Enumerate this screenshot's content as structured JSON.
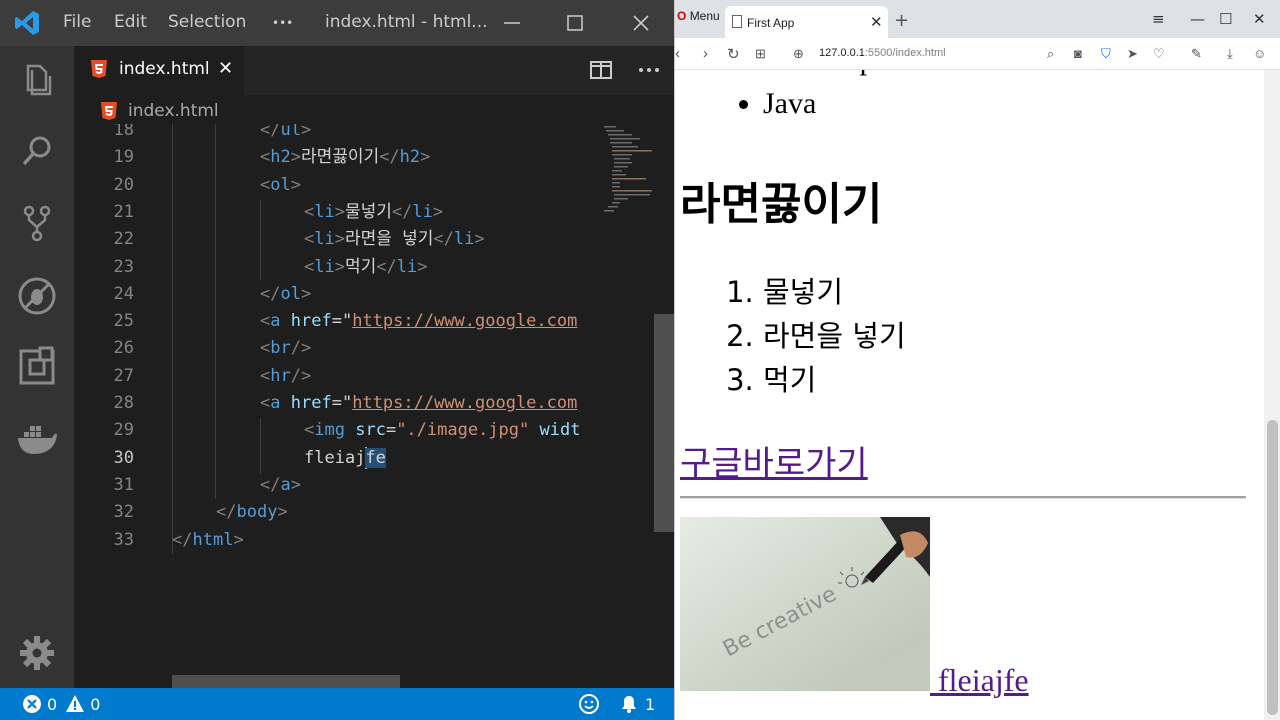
{
  "vscode": {
    "menu": [
      "File",
      "Edit",
      "Selection",
      "•••"
    ],
    "window_title": "index.html - html...",
    "tab": {
      "filename": "index.html",
      "close": "✕"
    },
    "breadcrumb": "index.html",
    "lines": [
      {
        "num": "18",
        "indent": 2,
        "parts": [
          {
            "t": "</",
            "c": "brk"
          },
          {
            "t": "ul",
            "c": "tag"
          },
          {
            "t": ">",
            "c": "brk"
          }
        ]
      },
      {
        "num": "19",
        "indent": 2,
        "parts": [
          {
            "t": "<",
            "c": "brk"
          },
          {
            "t": "h2",
            "c": "tag"
          },
          {
            "t": ">",
            "c": "brk"
          },
          {
            "t": "라면끓이기",
            "c": "txt"
          },
          {
            "t": "</",
            "c": "brk"
          },
          {
            "t": "h2",
            "c": "tag"
          },
          {
            "t": ">",
            "c": "brk"
          }
        ]
      },
      {
        "num": "20",
        "indent": 2,
        "parts": [
          {
            "t": "<",
            "c": "brk"
          },
          {
            "t": "ol",
            "c": "tag"
          },
          {
            "t": ">",
            "c": "brk"
          }
        ]
      },
      {
        "num": "21",
        "indent": 3,
        "parts": [
          {
            "t": "<",
            "c": "brk"
          },
          {
            "t": "li",
            "c": "tag"
          },
          {
            "t": ">",
            "c": "brk"
          },
          {
            "t": "물넣기",
            "c": "txt"
          },
          {
            "t": "</",
            "c": "brk"
          },
          {
            "t": "li",
            "c": "tag"
          },
          {
            "t": ">",
            "c": "brk"
          }
        ]
      },
      {
        "num": "22",
        "indent": 3,
        "parts": [
          {
            "t": "<",
            "c": "brk"
          },
          {
            "t": "li",
            "c": "tag"
          },
          {
            "t": ">",
            "c": "brk"
          },
          {
            "t": "라면을 넣기",
            "c": "txt"
          },
          {
            "t": "</",
            "c": "brk"
          },
          {
            "t": "li",
            "c": "tag"
          },
          {
            "t": ">",
            "c": "brk"
          }
        ]
      },
      {
        "num": "23",
        "indent": 3,
        "parts": [
          {
            "t": "<",
            "c": "brk"
          },
          {
            "t": "li",
            "c": "tag"
          },
          {
            "t": ">",
            "c": "brk"
          },
          {
            "t": "먹기",
            "c": "txt"
          },
          {
            "t": "</",
            "c": "brk"
          },
          {
            "t": "li",
            "c": "tag"
          },
          {
            "t": ">",
            "c": "brk"
          }
        ]
      },
      {
        "num": "24",
        "indent": 2,
        "parts": [
          {
            "t": "</",
            "c": "brk"
          },
          {
            "t": "ol",
            "c": "tag"
          },
          {
            "t": ">",
            "c": "brk"
          }
        ]
      },
      {
        "num": "25",
        "indent": 2,
        "parts": [
          {
            "t": "<",
            "c": "brk"
          },
          {
            "t": "a",
            "c": "tag"
          },
          {
            "t": " ",
            "c": "txt"
          },
          {
            "t": "href",
            "c": "attr"
          },
          {
            "t": "=\"",
            "c": "txt"
          },
          {
            "t": "https://www.google.com",
            "c": "str link"
          }
        ]
      },
      {
        "num": "26",
        "indent": 2,
        "parts": [
          {
            "t": "<",
            "c": "brk"
          },
          {
            "t": "br",
            "c": "tag"
          },
          {
            "t": "/>",
            "c": "brk"
          }
        ]
      },
      {
        "num": "27",
        "indent": 2,
        "parts": [
          {
            "t": "<",
            "c": "brk"
          },
          {
            "t": "hr",
            "c": "tag"
          },
          {
            "t": "/>",
            "c": "brk"
          }
        ]
      },
      {
        "num": "28",
        "indent": 2,
        "parts": [
          {
            "t": "<",
            "c": "brk"
          },
          {
            "t": "a",
            "c": "tag"
          },
          {
            "t": " ",
            "c": "txt"
          },
          {
            "t": "href",
            "c": "attr"
          },
          {
            "t": "=\"",
            "c": "txt"
          },
          {
            "t": "https://www.google.com",
            "c": "str link"
          }
        ]
      },
      {
        "num": "29",
        "indent": 3,
        "parts": [
          {
            "t": "<",
            "c": "brk"
          },
          {
            "t": "img",
            "c": "tag"
          },
          {
            "t": " ",
            "c": "txt"
          },
          {
            "t": "src",
            "c": "attr"
          },
          {
            "t": "=",
            "c": "txt"
          },
          {
            "t": "\"./image.jpg\"",
            "c": "str"
          },
          {
            "t": " ",
            "c": "txt"
          },
          {
            "t": "widt",
            "c": "attr"
          }
        ]
      },
      {
        "num": "30",
        "indent": 3,
        "active": true,
        "parts": [
          {
            "t": "fleiaj",
            "c": "txt"
          },
          {
            "t": "|",
            "c": "cursor"
          },
          {
            "t": "fe",
            "c": "txt sel"
          }
        ]
      },
      {
        "num": "31",
        "indent": 2,
        "parts": [
          {
            "t": "</",
            "c": "brk"
          },
          {
            "t": "a",
            "c": "tag"
          },
          {
            "t": ">",
            "c": "brk"
          }
        ]
      },
      {
        "num": "32",
        "indent": 1,
        "parts": [
          {
            "t": "</",
            "c": "brk"
          },
          {
            "t": "body",
            "c": "tag"
          },
          {
            "t": ">",
            "c": "brk"
          }
        ]
      },
      {
        "num": "33",
        "indent": 0,
        "parts": [
          {
            "t": "</",
            "c": "brk"
          },
          {
            "t": "html",
            "c": "tag"
          },
          {
            "t": ">",
            "c": "brk"
          }
        ]
      }
    ],
    "status": {
      "errors": "0",
      "warnings": "0",
      "notifications": "1"
    },
    "colors": {
      "statusbar": "#007acc",
      "tag": "#569cd6",
      "attr": "#9cdcfe",
      "string": "#ce9178"
    }
  },
  "browser": {
    "menu_label": "Menu",
    "tab_title": "First App",
    "url_host": "127.0.0.1",
    "url_rest": ":5500/index.html",
    "page": {
      "ul_items": [
        "Javascript",
        "Java"
      ],
      "heading": "라면끓이기",
      "ol_items": [
        "물넣기",
        "라면을 넣기",
        "먹기"
      ],
      "link_text": "구글바로가기",
      "image_link_text": " fleiajfe",
      "image_text": "Be creative"
    },
    "colors": {
      "visited_link": "#551a8b"
    }
  }
}
